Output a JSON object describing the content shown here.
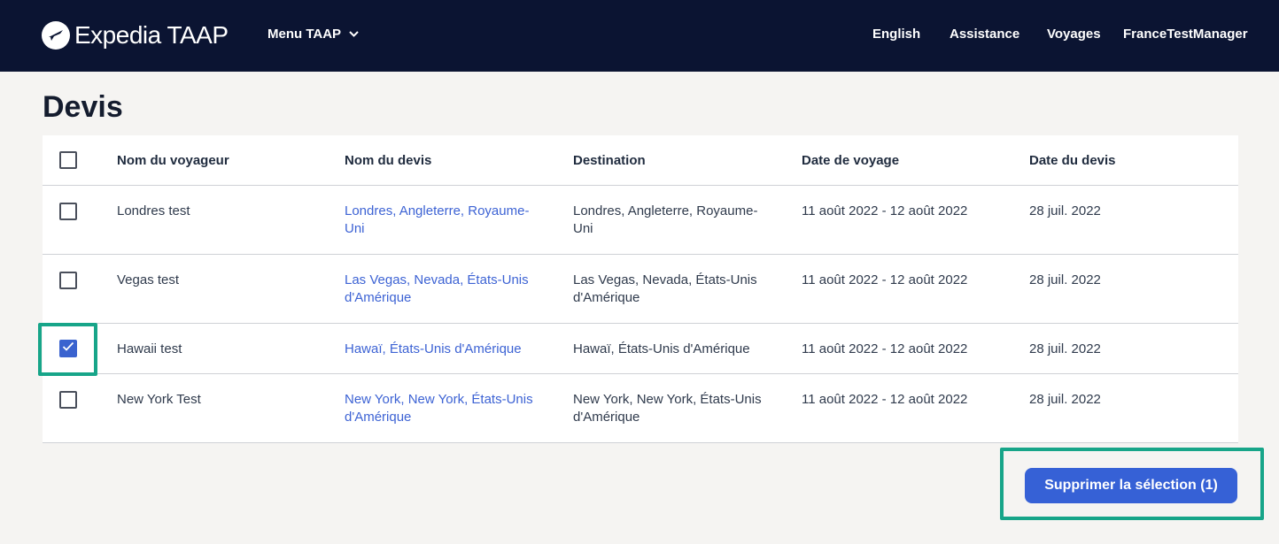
{
  "header": {
    "brand": "Expedia TAAP",
    "menu_label": "Menu TAAP",
    "nav": {
      "language": "English",
      "assistance": "Assistance",
      "trips": "Voyages",
      "account": "FranceTestManager"
    }
  },
  "page": {
    "title": "Devis"
  },
  "table": {
    "columns": {
      "traveler": "Nom du voyageur",
      "quote": "Nom du devis",
      "destination": "Destination",
      "travel_date": "Date de voyage",
      "quote_date": "Date du devis"
    },
    "rows": [
      {
        "traveler": "Londres test",
        "quote": "Londres, Angleterre, Royaume-Uni",
        "destination": "Londres, Angleterre, Royaume-Uni",
        "travel_date": "11 août 2022 - 12 août 2022",
        "quote_date": "28 juil. 2022",
        "checked": false
      },
      {
        "traveler": "Vegas test",
        "quote": "Las Vegas, Nevada, États-Unis d'Amérique",
        "destination": "Las Vegas, Nevada, États-Unis d'Amérique",
        "travel_date": "11 août 2022 - 12 août 2022",
        "quote_date": "28 juil. 2022",
        "checked": false
      },
      {
        "traveler": "Hawaii test",
        "quote": "Hawaï, États-Unis d'Amérique",
        "destination": "Hawaï, États-Unis d'Amérique",
        "travel_date": "11 août 2022 - 12 août 2022",
        "quote_date": "28 juil. 2022",
        "checked": true
      },
      {
        "traveler": "New York Test",
        "quote": "New York, New York, États-Unis d'Amérique",
        "destination": "New York, New York, États-Unis d'Amérique",
        "travel_date": "11 août 2022 - 12 août 2022",
        "quote_date": "28 juil. 2022",
        "checked": false
      }
    ]
  },
  "actions": {
    "delete_label": "Supprimer la sélection (1)"
  },
  "colors": {
    "header_bg": "#0b1432",
    "link": "#3d63d4",
    "primary_button": "#3661d6",
    "highlight": "#17a589"
  },
  "icons": {
    "logo": "plane-globe-icon",
    "menu": "chevron-down-icon",
    "checkbox_checked": "check-icon"
  }
}
